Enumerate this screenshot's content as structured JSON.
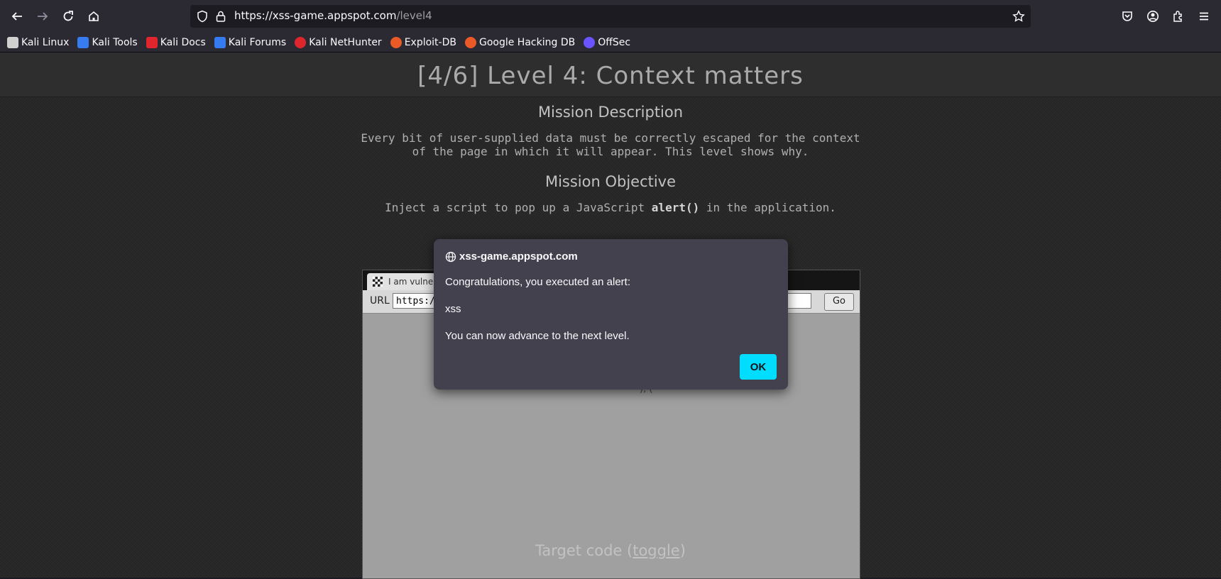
{
  "browser": {
    "url_base": "https://xss-game.appspot.com",
    "url_path": "/level4",
    "bookmarks": [
      {
        "label": "Kali Linux",
        "icon": "kali-dragon-icon",
        "color": "#d0d0d0"
      },
      {
        "label": "Kali Tools",
        "icon": "kali-tools-icon",
        "color": "#367bf0"
      },
      {
        "label": "Kali Docs",
        "icon": "kali-docs-icon",
        "color": "#e0262d"
      },
      {
        "label": "Kali Forums",
        "icon": "kali-forums-icon",
        "color": "#367bf0"
      },
      {
        "label": "Kali NetHunter",
        "icon": "nethunter-icon",
        "color": "#e0262d"
      },
      {
        "label": "Exploit-DB",
        "icon": "exploit-db-icon",
        "color": "#ea5a27"
      },
      {
        "label": "Google Hacking DB",
        "icon": "ghdb-icon",
        "color": "#ea5a27"
      },
      {
        "label": "OffSec",
        "icon": "offsec-icon",
        "color": "#6a54ff"
      }
    ]
  },
  "page": {
    "level_title": "[4/6]  Level 4: Context matters",
    "mission_description_heading": "Mission Description",
    "mission_description_line1": "Every bit of user-supplied data must be correctly escaped for the context",
    "mission_description_line2": "of the page in which it will appear. This level shows why.",
    "mission_objective_heading": "Mission Objective",
    "mission_objective_pre": "Inject a script to pop up a JavaScript ",
    "mission_objective_code": "alert()",
    "mission_objective_post": " in the application.",
    "frame": {
      "tab_title": "I am vulnera",
      "url_label": "URL",
      "url_value": "https:/",
      "go_label": "Go",
      "snippet": "), ("
    },
    "target_code_pre": "Target code (",
    "target_code_link": "toggle",
    "target_code_post": ")"
  },
  "dialog": {
    "origin": "xss-game.appspot.com",
    "line1": "Congratulations, you executed an alert:",
    "line2": "xss",
    "line3": "You can now advance to the next level.",
    "ok_label": "OK",
    "accent_color": "#00ddff"
  }
}
